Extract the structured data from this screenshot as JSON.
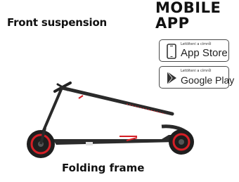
{
  "labels": {
    "front_suspension": "Front suspension",
    "folding_frame": "Folding frame"
  },
  "app": {
    "title_line1": "MOBILE",
    "title_line2": "APP"
  },
  "badges": {
    "appstore": {
      "small": "Letölteni a címről",
      "big": "App Store",
      "icon": "phone-icon"
    },
    "google": {
      "small": "Letölteni a címről",
      "big": "Google Play",
      "icon": "play-icon"
    }
  },
  "colors": {
    "accent_red": "#d61f26",
    "frame_dark": "#2a2a2a"
  }
}
